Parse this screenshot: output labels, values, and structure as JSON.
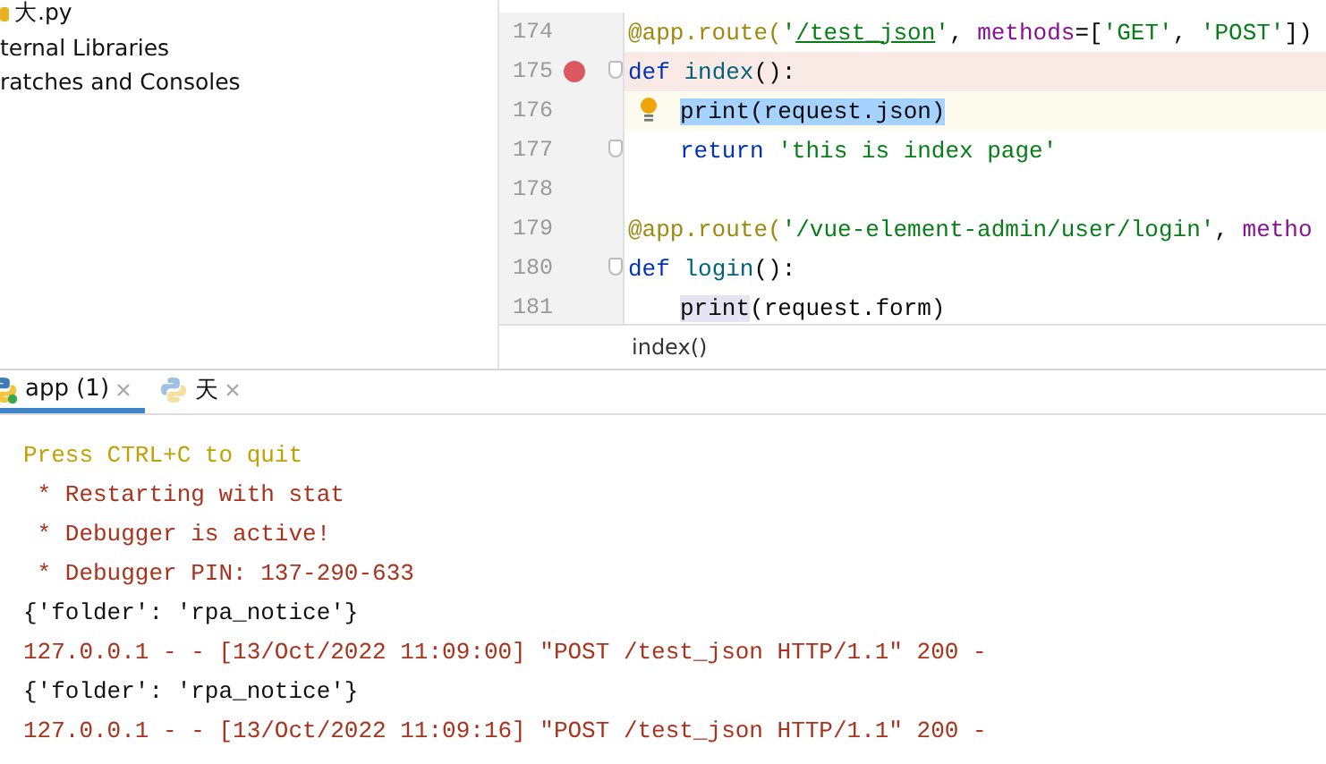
{
  "project_tree": {
    "items": [
      {
        "label": "大.py",
        "kind": "file"
      },
      {
        "label": "ternal Libraries",
        "kind": "plain"
      },
      {
        "label": "ratches and Consoles",
        "kind": "plain"
      }
    ]
  },
  "editor": {
    "lines": [
      {
        "number": "174",
        "breakpoint": false,
        "caret": false,
        "fold": false,
        "bulb": false,
        "indented": false,
        "tokens": [
          {
            "text": "@app.route(",
            "kind": "deco"
          },
          {
            "text": "'",
            "kind": "str"
          },
          {
            "text": "/test_json",
            "kind": "link"
          },
          {
            "text": "'",
            "kind": "str"
          },
          {
            "text": ", ",
            "kind": "plain"
          },
          {
            "text": "methods",
            "kind": "param"
          },
          {
            "text": "=[",
            "kind": "plain"
          },
          {
            "text": "'GET'",
            "kind": "str"
          },
          {
            "text": ", ",
            "kind": "plain"
          },
          {
            "text": "'POST'",
            "kind": "str"
          },
          {
            "text": "])",
            "kind": "plain"
          }
        ]
      },
      {
        "number": "175",
        "breakpoint": true,
        "caret": false,
        "fold": true,
        "bulb": false,
        "indented": false,
        "tokens": [
          {
            "text": "def ",
            "kind": "kw"
          },
          {
            "text": "index",
            "kind": "fn"
          },
          {
            "text": "():",
            "kind": "plain"
          }
        ]
      },
      {
        "number": "176",
        "breakpoint": false,
        "caret": true,
        "fold": false,
        "bulb": true,
        "indented": true,
        "tokens": [
          {
            "text": "print(request.json)",
            "kind": "plain",
            "selected": true
          }
        ]
      },
      {
        "number": "177",
        "breakpoint": false,
        "caret": false,
        "fold": true,
        "bulb": false,
        "indented": true,
        "tokens": [
          {
            "text": "return ",
            "kind": "kw"
          },
          {
            "text": "'this is index page'",
            "kind": "str"
          }
        ]
      },
      {
        "number": "178",
        "breakpoint": false,
        "caret": false,
        "fold": false,
        "bulb": false
      },
      {
        "number": "179",
        "breakpoint": false,
        "caret": false,
        "fold": false,
        "bulb": false,
        "indented": false,
        "tokens": [
          {
            "text": "@app.route(",
            "kind": "deco"
          },
          {
            "text": "'/vue-element-admin/user/login'",
            "kind": "str"
          },
          {
            "text": ", ",
            "kind": "plain"
          },
          {
            "text": "metho",
            "kind": "param"
          }
        ]
      },
      {
        "number": "180",
        "breakpoint": false,
        "caret": false,
        "fold": true,
        "bulb": false,
        "indented": false,
        "tokens": [
          {
            "text": "def ",
            "kind": "kw"
          },
          {
            "text": "login",
            "kind": "fn"
          },
          {
            "text": "():",
            "kind": "plain"
          }
        ]
      },
      {
        "number": "181",
        "breakpoint": false,
        "caret": false,
        "fold": false,
        "bulb": false,
        "indented": true,
        "tokens": [
          {
            "text": "print",
            "kind": "usage"
          },
          {
            "text": "(request.form)",
            "kind": "plain"
          }
        ]
      }
    ],
    "breadcrumb": "index()"
  },
  "run_tabs": [
    {
      "label": "app (1)",
      "selected": true,
      "running": true
    },
    {
      "label": "天",
      "selected": false,
      "running": false
    }
  ],
  "console": {
    "lines": [
      {
        "text": "Press CTRL+C to quit",
        "kind": "warn"
      },
      {
        "text": " * Restarting with stat",
        "kind": "err"
      },
      {
        "text": " * Debugger is active!",
        "kind": "err"
      },
      {
        "text": " * Debugger PIN: 137-290-633",
        "kind": "err"
      },
      {
        "text": "{'folder': 'rpa_notice'}",
        "kind": "out"
      },
      {
        "text": "127.0.0.1 - - [13/Oct/2022 11:09:00] \"POST /test_json HTTP/1.1\" 200 -",
        "kind": "err"
      },
      {
        "text": "{'folder': 'rpa_notice'}",
        "kind": "out"
      },
      {
        "text": "127.0.0.1 - - [13/Oct/2022 11:09:16] \"POST /test_json HTTP/1.1\" 200 -",
        "kind": "err"
      }
    ]
  }
}
